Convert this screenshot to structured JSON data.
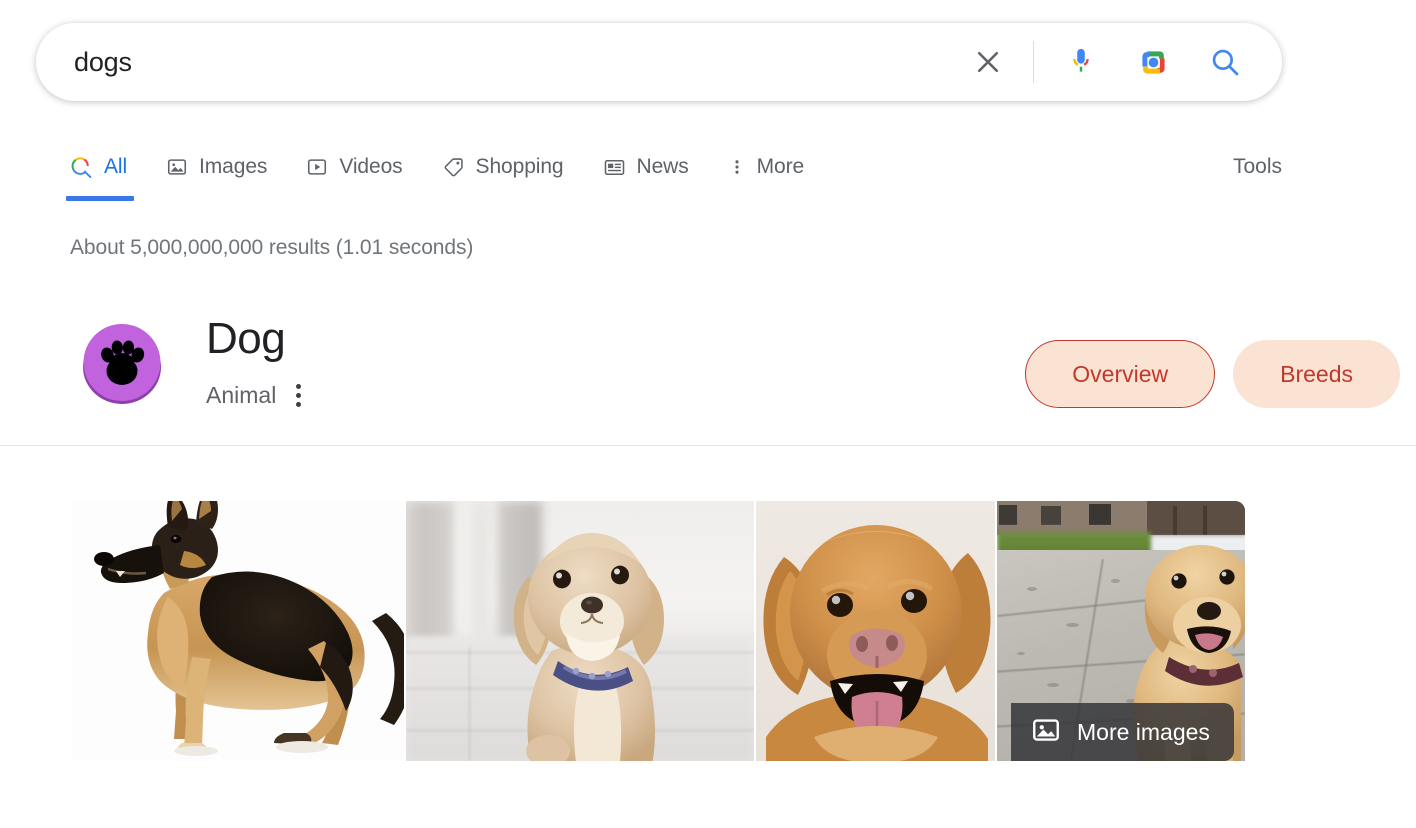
{
  "search": {
    "query": "dogs",
    "placeholder": "Search Google or type a URL",
    "clear_icon": "close-x-icon",
    "voice_icon": "microphone-icon",
    "lens_icon": "google-lens-camera-icon",
    "submit_icon": "search-magnifier-icon"
  },
  "tabs": [
    {
      "label": "All",
      "icon": "search-colored-icon",
      "active": true
    },
    {
      "label": "Images",
      "icon": "image-icon",
      "active": false
    },
    {
      "label": "Videos",
      "icon": "video-play-icon",
      "active": false
    },
    {
      "label": "Shopping",
      "icon": "price-tag-icon",
      "active": false
    },
    {
      "label": "News",
      "icon": "newspaper-icon",
      "active": false
    },
    {
      "label": "More",
      "icon": "more-vertical-icon",
      "active": false
    }
  ],
  "tools_label": "Tools",
  "result_stats": "About 5,000,000,000 results (1.01 seconds)",
  "knowledge_panel": {
    "avatar_icon": "paw-print-badge-icon",
    "title": "Dog",
    "subtitle": "Animal",
    "menu_icon": "more-vertical-icon",
    "chips": [
      {
        "label": "Overview",
        "selected": true
      },
      {
        "label": "Breeds",
        "selected": false
      }
    ]
  },
  "images": [
    {
      "alt": "German Shepherd standing in profile on white background"
    },
    {
      "alt": "Cream Cockapoo puppy wearing a blue collar"
    },
    {
      "alt": "Golden retriever face close-up with tongue out"
    },
    {
      "alt": "Golden retriever puppy walking on a sidewalk"
    }
  ],
  "more_images": {
    "label": "More images",
    "icon": "image-icon"
  },
  "colors": {
    "google_blue": "#1a73e8",
    "tab_underline": "#3b78e7",
    "text_primary": "#202124",
    "text_secondary": "#5f6368",
    "stats_gray": "#70757a",
    "chip_bg": "#fbe3d4",
    "chip_text": "#c0392b",
    "avatar_purple": "#c163dd",
    "divider": "#e4e6e8"
  }
}
